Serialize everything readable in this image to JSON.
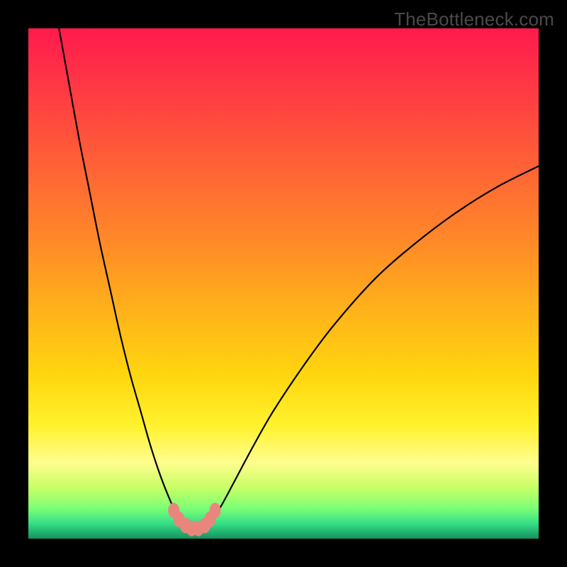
{
  "watermark": "TheBottleneck.com",
  "chart_data": {
    "type": "line",
    "title": "",
    "xlabel": "",
    "ylabel": "",
    "xlim": [
      0,
      100
    ],
    "ylim": [
      0,
      100
    ],
    "series": [
      {
        "name": "left-curve",
        "x": [
          6,
          8,
          10,
          12,
          14,
          16,
          18,
          20,
          22,
          24,
          26,
          28,
          29,
          30,
          31,
          32
        ],
        "y": [
          100,
          89,
          78,
          68,
          58,
          49,
          40,
          32,
          25,
          18,
          12,
          7,
          5,
          3.5,
          2.2,
          1.5
        ]
      },
      {
        "name": "right-curve",
        "x": [
          34,
          35,
          36,
          38,
          40,
          44,
          48,
          54,
          60,
          68,
          76,
          84,
          92,
          100
        ],
        "y": [
          1.5,
          2.4,
          3.6,
          6.8,
          10.5,
          18,
          25,
          34,
          42,
          51,
          58,
          64,
          69,
          73
        ]
      }
    ],
    "markers": {
      "name": "bottom-cluster",
      "color": "#e8867e",
      "points": [
        {
          "x": 28.5,
          "y": 5.5
        },
        {
          "x": 29.5,
          "y": 3.8
        },
        {
          "x": 30.8,
          "y": 2.6
        },
        {
          "x": 32.0,
          "y": 2.0
        },
        {
          "x": 33.3,
          "y": 2.0
        },
        {
          "x": 34.6,
          "y": 2.6
        },
        {
          "x": 35.6,
          "y": 3.8
        },
        {
          "x": 36.6,
          "y": 5.5
        }
      ]
    },
    "gradient_colors": {
      "top": "#ff1a4d",
      "mid_upper": "#ff8a28",
      "mid": "#ffd60f",
      "mid_lower": "#fff22e",
      "bottom_upper": "#7cff74",
      "bottom": "#1a9060"
    }
  }
}
